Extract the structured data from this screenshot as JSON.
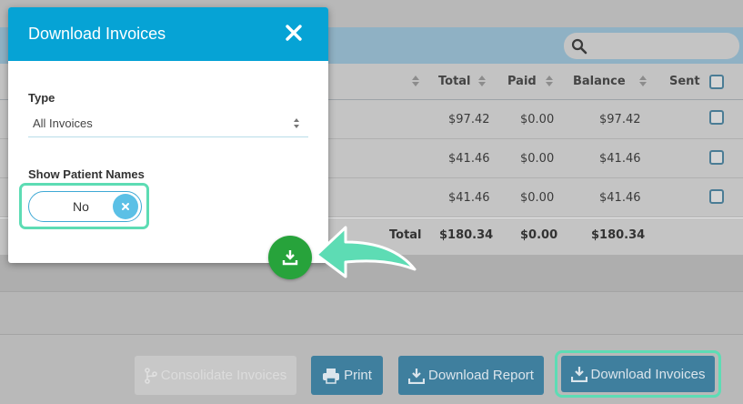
{
  "table": {
    "columns": {
      "total": "Total",
      "paid": "Paid",
      "balance": "Balance",
      "sent": "Sent"
    },
    "rows": [
      {
        "total": "$97.42",
        "paid": "$0.00",
        "balance": "$97.42"
      },
      {
        "total": "$41.46",
        "paid": "$0.00",
        "balance": "$41.46"
      },
      {
        "total": "$41.46",
        "paid": "$0.00",
        "balance": "$41.46"
      }
    ],
    "totals": {
      "label": "Total",
      "total": "$180.34",
      "paid": "$0.00",
      "balance": "$180.34"
    }
  },
  "actions": {
    "consolidate_label": "Consolidate Invoices",
    "print_label": "Print",
    "download_report_label": "Download Report",
    "download_invoices_label": "Download Invoices"
  },
  "modal": {
    "title": "Download Invoices",
    "type_label": "Type",
    "type_value": "All Invoices",
    "patient_names_label": "Show Patient Names",
    "patient_names_value": "No"
  },
  "colors": {
    "modal_header": "#06a3d5",
    "primary_button": "#3f7f9e",
    "highlight": "#5ddcb4",
    "download_fab": "#27a33b"
  },
  "icons": {
    "close": "close-icon",
    "search": "search-icon",
    "download": "download-icon",
    "print": "printer-icon",
    "consolidate": "merge-icon",
    "toggle_off": "x-icon",
    "arrow": "pointer-arrow-icon"
  }
}
